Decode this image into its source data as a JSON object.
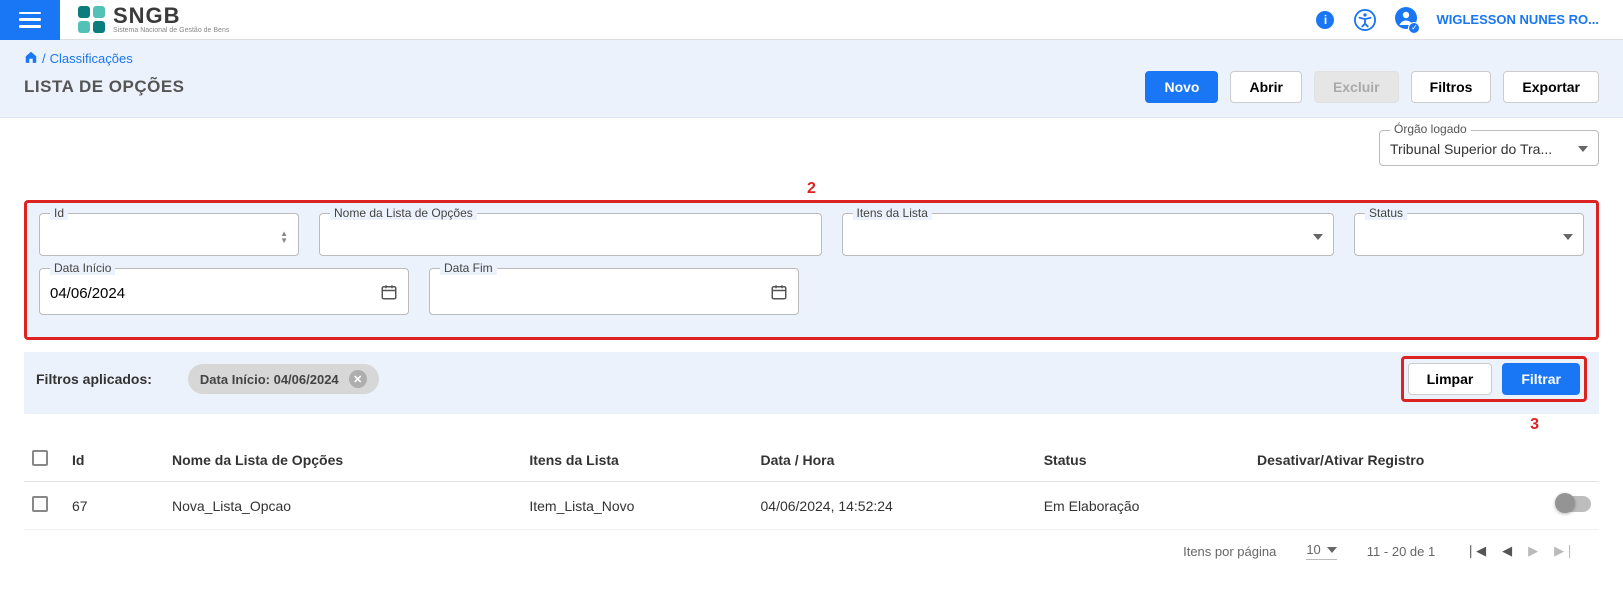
{
  "header": {
    "logo_main": "SNGB",
    "logo_sub": "Sistema Nacional de Gestão de Bens",
    "user_name": "WIGLESSON NUNES RO..."
  },
  "breadcrumb": {
    "sep": " / ",
    "item1": "Classificações"
  },
  "page_title": "LISTA DE OPÇÕES",
  "actions": {
    "novo": "Novo",
    "abrir": "Abrir",
    "excluir": "Excluir",
    "filtros": "Filtros",
    "exportar": "Exportar"
  },
  "orgao": {
    "label": "Órgão logado",
    "value": "Tribunal Superior do Tra..."
  },
  "callouts": {
    "two": "2",
    "three": "3"
  },
  "filters": {
    "id_label": "Id",
    "nome_label": "Nome da Lista de Opções",
    "itens_label": "Itens da Lista",
    "status_label": "Status",
    "data_inicio_label": "Data Início",
    "data_inicio_value": "04/06/2024",
    "data_fim_label": "Data Fim"
  },
  "applied": {
    "label": "Filtros aplicados:",
    "chip_text": "Data Início: 04/06/2024"
  },
  "filter_buttons": {
    "limpar": "Limpar",
    "filtrar": "Filtrar"
  },
  "table": {
    "headers": {
      "id": "Id",
      "nome": "Nome da Lista de Opções",
      "itens": "Itens da Lista",
      "data": "Data / Hora",
      "status": "Status",
      "toggle": "Desativar/Ativar Registro"
    },
    "rows": [
      {
        "id": "67",
        "nome": "Nova_Lista_Opcao",
        "itens": "Item_Lista_Novo",
        "data": "04/06/2024, 14:52:24",
        "status": "Em Elaboração"
      }
    ]
  },
  "pagination": {
    "items_label": "Itens por página",
    "items_value": "10",
    "range": "11 - 20 de 1"
  }
}
